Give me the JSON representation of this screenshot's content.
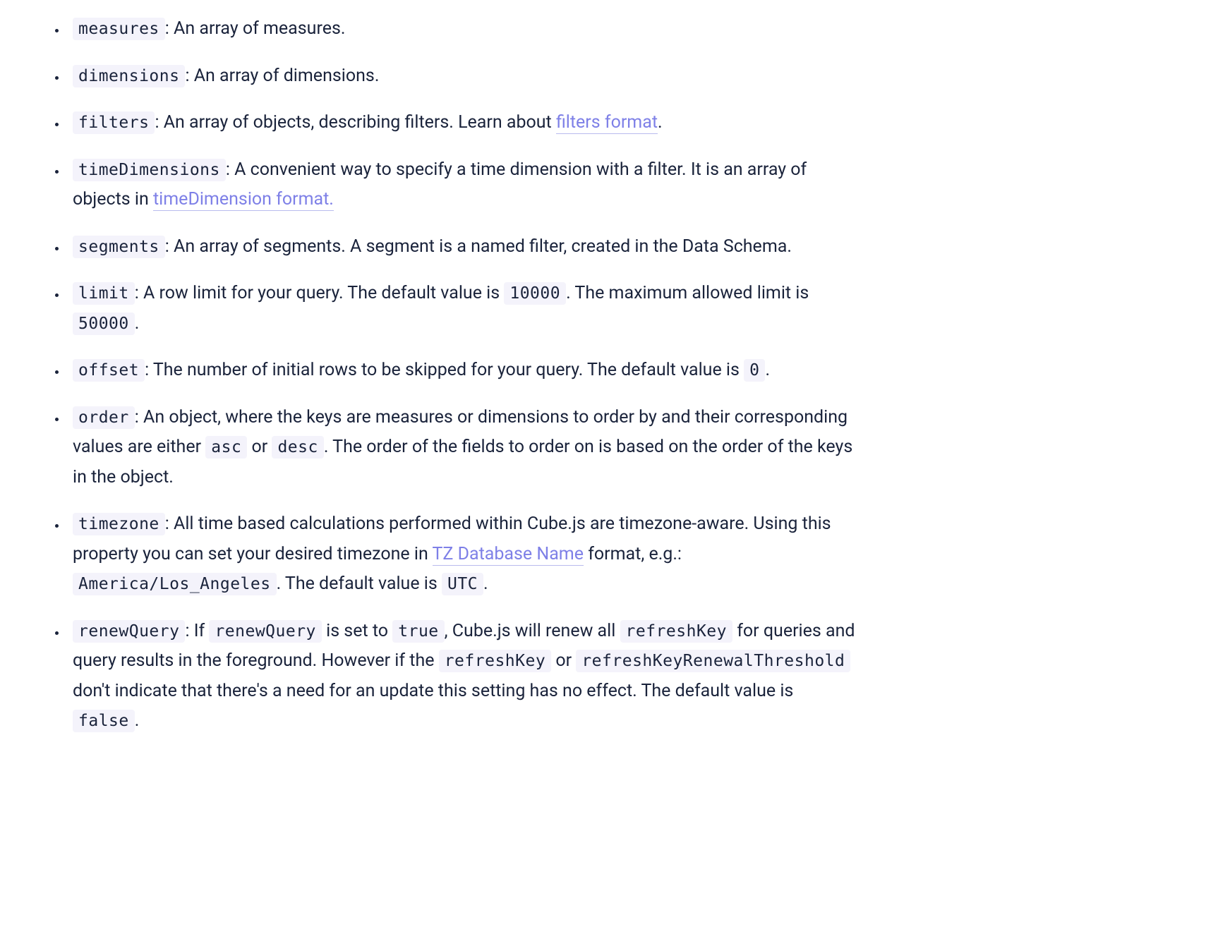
{
  "items": [
    {
      "term": "measures",
      "text1": ": An array of measures."
    },
    {
      "term": "dimensions",
      "text1": ": An array of dimensions."
    },
    {
      "term": "filters",
      "text1": ": An array of objects, describing filters. Learn about ",
      "link1": "filters format",
      "text2": "."
    },
    {
      "term": "timeDimensions",
      "text1": ": A convenient way to specify a time dimension with a filter. It is an array of objects in ",
      "link1": "timeDimension format.",
      "text2": ""
    },
    {
      "term": "segments",
      "text1": ": An array of segments. A segment is a named filter, created in the Data Schema."
    },
    {
      "term": "limit",
      "text1": ": A row limit for your query. The default value is ",
      "code1": "10000",
      "text2": ". The maximum allowed limit is ",
      "code2": "50000",
      "text3": "."
    },
    {
      "term": "offset",
      "text1": ": The number of initial rows to be skipped for your query. The default value is ",
      "code1": "0",
      "text2": "."
    },
    {
      "term": "order",
      "text1": ": An object, where the keys are measures or dimensions to order by and their corresponding values are either ",
      "code1": "asc",
      "text2": " or ",
      "code2": "desc",
      "text3": ". The order of the fields to order on is based on the order of the keys in the object."
    },
    {
      "term": "timezone",
      "text1": ": All time based calculations performed within Cube.js are timezone-aware. Using this property you can set your desired timezone in ",
      "link1": "TZ Database Name",
      "text2": " format, e.g.: ",
      "code1": "America/Los_Angeles",
      "text3": ". The default value is ",
      "code2": "UTC",
      "text4": "."
    },
    {
      "term": "renewQuery",
      "text1": ": If ",
      "code1": "renewQuery",
      "text2": " is set to ",
      "code2": "true",
      "text3": ", Cube.js will renew all ",
      "code3": "refreshKey",
      "text4": " for queries and query results in the foreground. However if the ",
      "code4": "refreshKey",
      "text5": " or ",
      "code5": "refreshKeyRenewalThreshold",
      "text6": " don't indicate that there's a need for an update this setting has no effect. The default value is ",
      "code6": "false",
      "text7": "."
    }
  ]
}
